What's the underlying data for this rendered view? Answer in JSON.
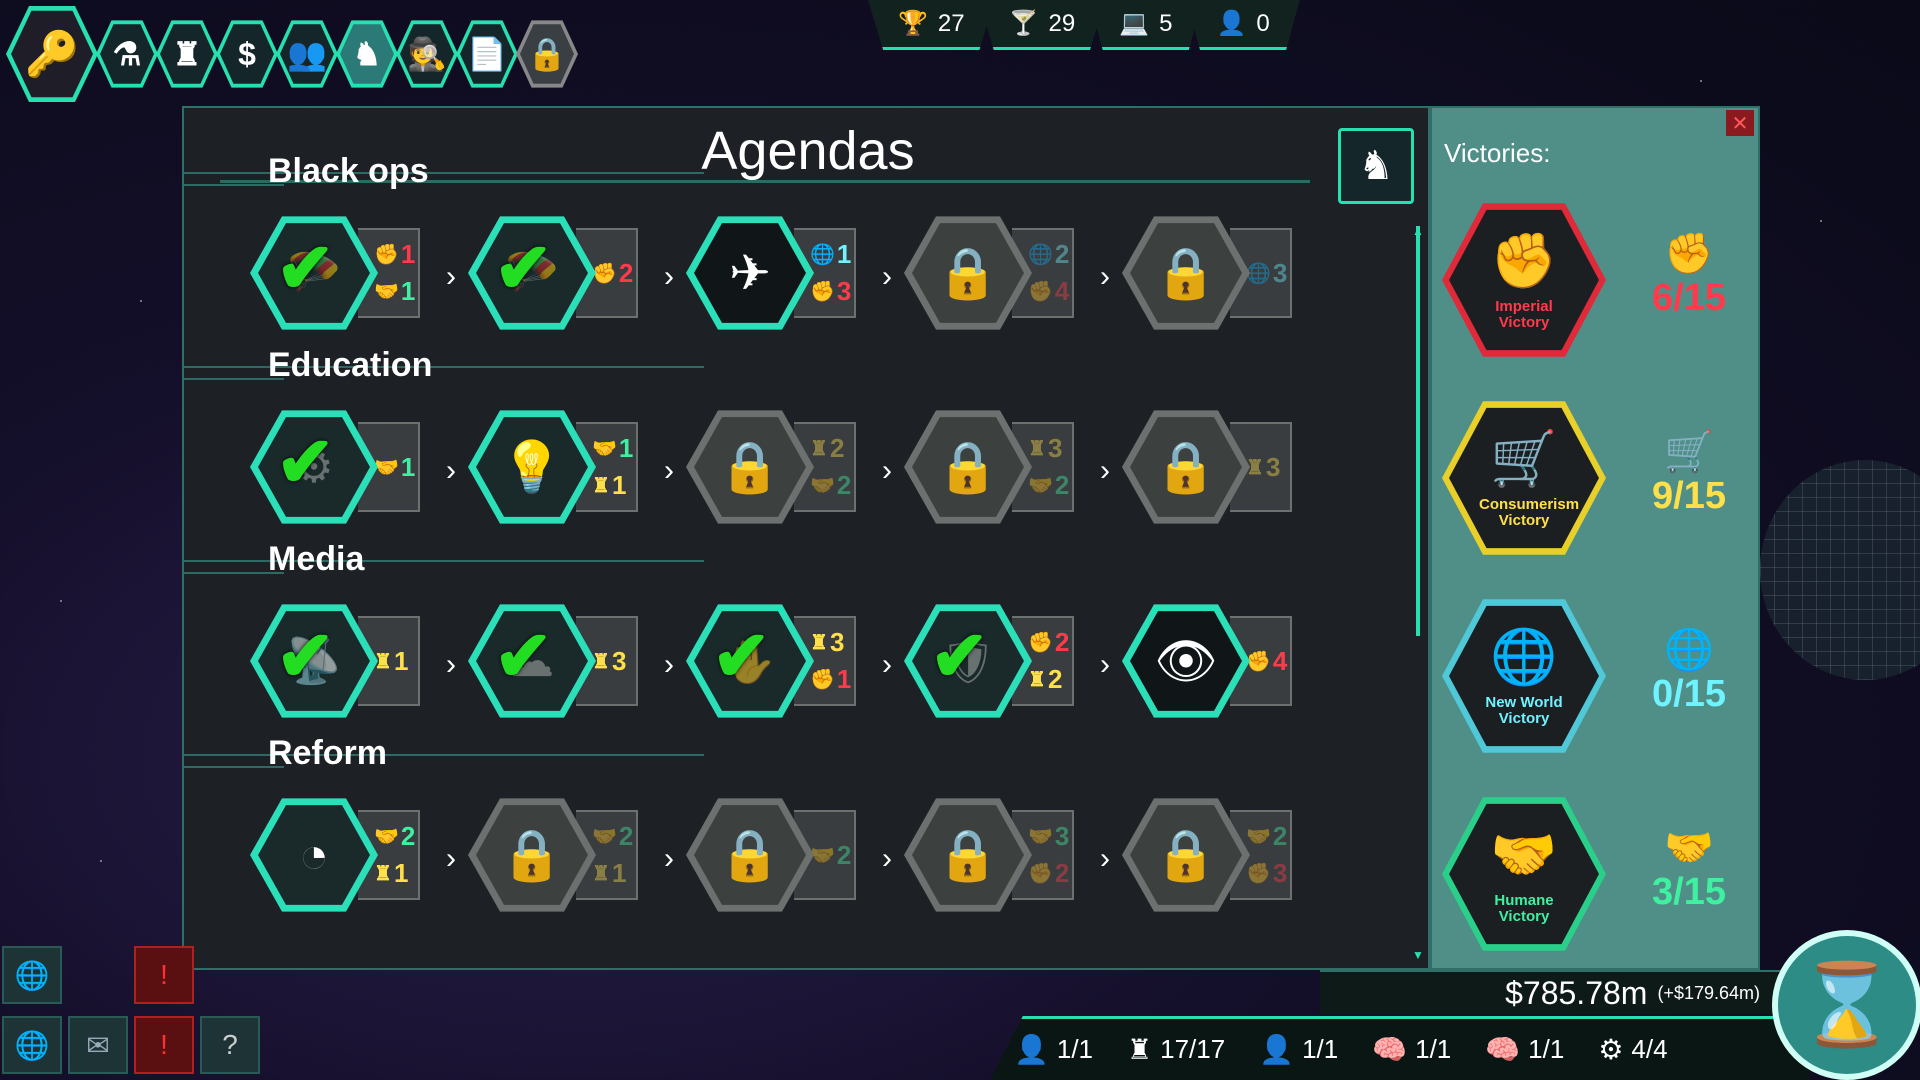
{
  "toolbar": {
    "items": [
      {
        "icon": "key-icon",
        "glyph": "🔑"
      },
      {
        "icon": "flask-icon",
        "glyph": "⚗"
      },
      {
        "icon": "puppet-icon",
        "glyph": "♜"
      },
      {
        "icon": "dollar-icon",
        "glyph": "$"
      },
      {
        "icon": "people-icon",
        "glyph": "👥"
      },
      {
        "icon": "knight-icon",
        "glyph": "♞"
      },
      {
        "icon": "spy-icon",
        "glyph": "🕵"
      },
      {
        "icon": "document-icon",
        "glyph": "📄"
      },
      {
        "icon": "lock-icon",
        "glyph": "🔒"
      }
    ]
  },
  "resources": [
    {
      "icon": "trophy-icon",
      "glyph": "🏆",
      "value": "27"
    },
    {
      "icon": "drink-icon",
      "glyph": "🍸",
      "value": "29"
    },
    {
      "icon": "laptop-icon",
      "glyph": "💻",
      "value": "5"
    },
    {
      "icon": "agent-icon",
      "glyph": "👤",
      "value": "0"
    }
  ],
  "panel": {
    "title": "Agendas",
    "sections": [
      {
        "name": "Black ops",
        "nodes": [
          {
            "state": "done",
            "icon": "parachute-icon",
            "glyph": "🪂",
            "reqs": [
              {
                "type": "red",
                "glyph": "✊",
                "v": "1"
              },
              {
                "type": "green",
                "glyph": "🤝",
                "v": "1"
              }
            ]
          },
          {
            "state": "done",
            "icon": "parachute-icon",
            "glyph": "🪂",
            "reqs": [
              {
                "type": "red",
                "glyph": "✊",
                "v": "2"
              }
            ]
          },
          {
            "state": "current",
            "icon": "jet-icon",
            "glyph": "✈",
            "reqs": [
              {
                "type": "cyan",
                "glyph": "🌐",
                "v": "1"
              },
              {
                "type": "red",
                "glyph": "✊",
                "v": "3"
              }
            ]
          },
          {
            "state": "locked",
            "icon": "lock-icon",
            "glyph": "🔒",
            "reqs": [
              {
                "type": "cyan dim",
                "glyph": "🌐",
                "v": "2"
              },
              {
                "type": "red dim",
                "glyph": "✊",
                "v": "4"
              }
            ]
          },
          {
            "state": "locked",
            "icon": "lock-icon",
            "glyph": "🔒",
            "reqs": [
              {
                "type": "cyan dim",
                "glyph": "🌐",
                "v": "3"
              }
            ]
          }
        ]
      },
      {
        "name": "Education",
        "nodes": [
          {
            "state": "done",
            "icon": "network-icon",
            "glyph": "⚙",
            "reqs": [
              {
                "type": "green",
                "glyph": "🤝",
                "v": "1"
              }
            ]
          },
          {
            "state": "unlocked",
            "icon": "idea-head-icon",
            "glyph": "💡",
            "reqs": [
              {
                "type": "green",
                "glyph": "🤝",
                "v": "1"
              },
              {
                "type": "yellow",
                "glyph": "♜",
                "v": "1"
              }
            ]
          },
          {
            "state": "locked",
            "icon": "lock-icon",
            "glyph": "🔒",
            "reqs": [
              {
                "type": "yellow dim",
                "glyph": "♜",
                "v": "2"
              },
              {
                "type": "green dim",
                "glyph": "🤝",
                "v": "2"
              }
            ]
          },
          {
            "state": "locked",
            "icon": "lock-icon",
            "glyph": "🔒",
            "reqs": [
              {
                "type": "yellow dim",
                "glyph": "♜",
                "v": "3"
              },
              {
                "type": "green dim",
                "glyph": "🤝",
                "v": "2"
              }
            ]
          },
          {
            "state": "locked",
            "icon": "lock-icon",
            "glyph": "🔒",
            "reqs": [
              {
                "type": "yellow dim",
                "glyph": "♜",
                "v": "3"
              }
            ]
          }
        ]
      },
      {
        "name": "Media",
        "nodes": [
          {
            "state": "done",
            "icon": "broadcast-icon",
            "glyph": "📡",
            "reqs": [
              {
                "type": "yellow",
                "glyph": "♜",
                "v": "1"
              }
            ]
          },
          {
            "state": "done",
            "icon": "cloud-pen-icon",
            "glyph": "☁",
            "reqs": [
              {
                "type": "yellow",
                "glyph": "♜",
                "v": "3"
              }
            ]
          },
          {
            "state": "done",
            "icon": "hand-signal-icon",
            "glyph": "✋",
            "reqs": [
              {
                "type": "yellow",
                "glyph": "♜",
                "v": "3"
              },
              {
                "type": "red",
                "glyph": "✊",
                "v": "1"
              }
            ]
          },
          {
            "state": "done",
            "icon": "shield-icon",
            "glyph": "🛡",
            "reqs": [
              {
                "type": "red",
                "glyph": "✊",
                "v": "2"
              },
              {
                "type": "yellow",
                "glyph": "♜",
                "v": "2"
              }
            ]
          },
          {
            "state": "current",
            "icon": "monitor-eye-icon",
            "glyph": "👁",
            "reqs": [
              {
                "type": "red",
                "glyph": "✊",
                "v": "4"
              }
            ]
          }
        ]
      },
      {
        "name": "Reform",
        "nodes": [
          {
            "state": "unlocked",
            "icon": "pie-chart-icon",
            "glyph": "◔",
            "reqs": [
              {
                "type": "green",
                "glyph": "🤝",
                "v": "2"
              },
              {
                "type": "yellow",
                "glyph": "♜",
                "v": "1"
              }
            ]
          },
          {
            "state": "locked",
            "icon": "lock-icon",
            "glyph": "🔒",
            "reqs": [
              {
                "type": "green dim",
                "glyph": "🤝",
                "v": "2"
              },
              {
                "type": "yellow dim",
                "glyph": "♜",
                "v": "1"
              }
            ]
          },
          {
            "state": "locked",
            "icon": "lock-icon",
            "glyph": "🔒",
            "reqs": [
              {
                "type": "green dim",
                "glyph": "🤝",
                "v": "2"
              }
            ]
          },
          {
            "state": "locked",
            "icon": "lock-icon",
            "glyph": "🔒",
            "reqs": [
              {
                "type": "green dim",
                "glyph": "🤝",
                "v": "3"
              },
              {
                "type": "red dim",
                "glyph": "✊",
                "v": "2"
              }
            ]
          },
          {
            "state": "locked",
            "icon": "lock-icon",
            "glyph": "🔒",
            "reqs": [
              {
                "type": "green dim",
                "glyph": "🤝",
                "v": "2"
              },
              {
                "type": "red dim",
                "glyph": "✊",
                "v": "3"
              }
            ]
          }
        ]
      }
    ]
  },
  "victories": {
    "title": "Victories:",
    "items": [
      {
        "name": "Imperial Victory",
        "icon": "fist-laurel-icon",
        "glyph": "✊",
        "count": "6/15",
        "color": "#ff3b4b",
        "border": "#e02a3a"
      },
      {
        "name": "Consumerism Victory",
        "icon": "puppet-cart-icon",
        "glyph": "🛒",
        "count": "9/15",
        "color": "#ffe04a",
        "border": "#e8cf2a"
      },
      {
        "name": "New World Victory",
        "icon": "globe-people-icon",
        "glyph": "🌐",
        "count": "0/15",
        "color": "#6ff3ff",
        "border": "#4fc8d8"
      },
      {
        "name": "Humane Victory",
        "icon": "handshake-globe-icon",
        "glyph": "🤝",
        "count": "3/15",
        "color": "#3ff0a0",
        "border": "#2ad08a"
      }
    ]
  },
  "money": {
    "amount": "$785.78m",
    "delta": "(+$179.64m)"
  },
  "status": [
    {
      "icon": "agent-icon",
      "glyph": "👤",
      "value": "1/1"
    },
    {
      "icon": "puppet-icon",
      "glyph": "♜",
      "value": "17/17"
    },
    {
      "icon": "person-icon",
      "glyph": "👤",
      "value": "1/1"
    },
    {
      "icon": "head-icon",
      "glyph": "🧠",
      "value": "1/1"
    },
    {
      "icon": "brain-flag-icon",
      "glyph": "🧠",
      "value": "1/1"
    },
    {
      "icon": "brain-gear-icon",
      "glyph": "⚙",
      "value": "4/4"
    }
  ]
}
